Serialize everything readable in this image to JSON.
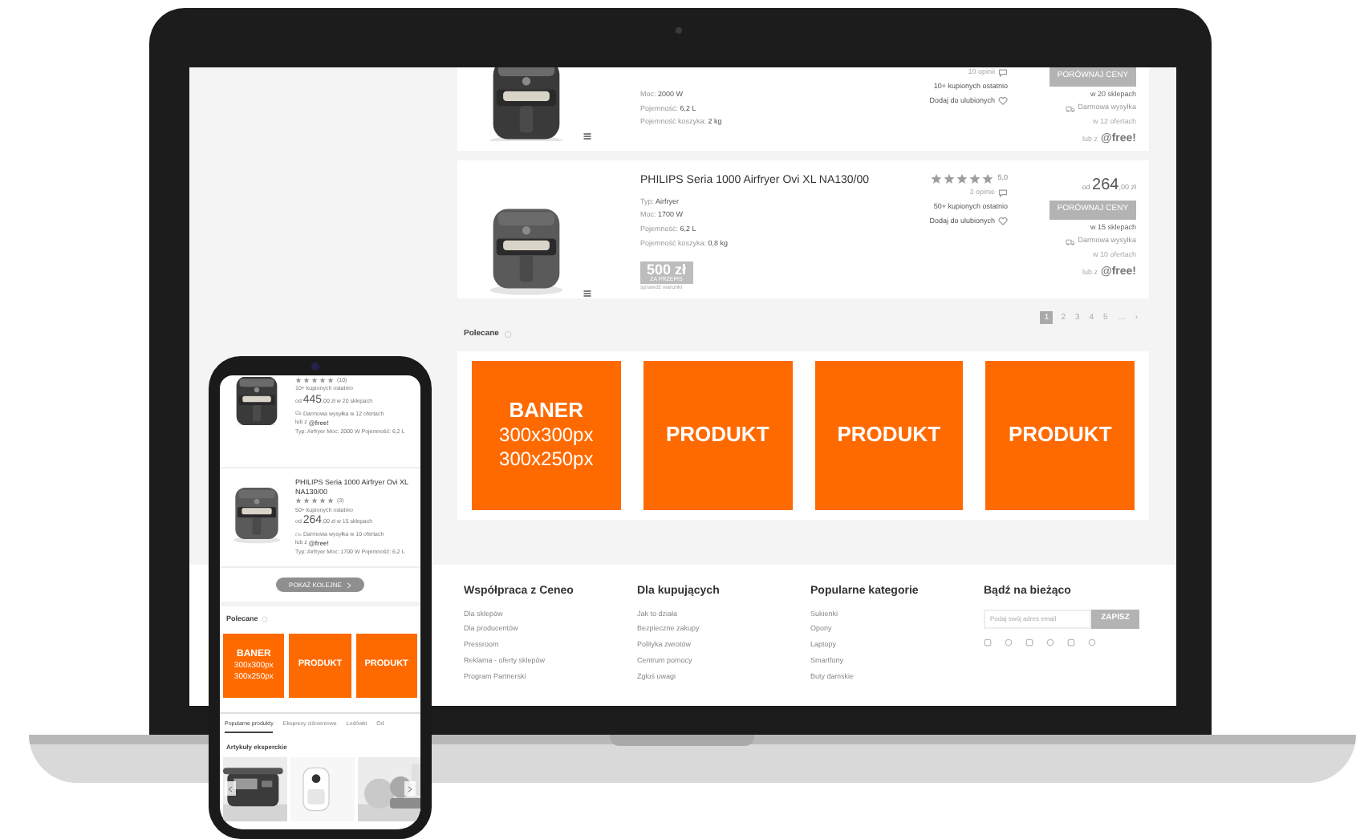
{
  "laptop": {
    "products": [
      {
        "specs": [
          {
            "label": "Moc:",
            "value": "2000 W"
          },
          {
            "label": "Pojemność:",
            "value": "6,2 L"
          },
          {
            "label": "Pojemność koszyka:",
            "value": "2 kg"
          }
        ],
        "opinions": "10 opinii",
        "bought": "10+ kupionych ostatnio",
        "favorite": "Dodaj do ulubionych",
        "compare": "PORÓWNAJ CENY",
        "shops": "w 20 sklepach",
        "shipping": "Darmowa wysyłka",
        "offers": "w 12 ofertach",
        "alt": "lub z",
        "alt_brand": "@free!"
      },
      {
        "title": "PHILIPS Seria 1000 Airfryer Ovi XL NA130/00",
        "specs": [
          {
            "label": "Typ:",
            "value": "Airfryer"
          },
          {
            "label": "Moc:",
            "value": "1700 W"
          },
          {
            "label": "Pojemność:",
            "value": "6,2 L"
          },
          {
            "label": "Pojemność koszyka:",
            "value": "0,8 kg"
          }
        ],
        "badge": {
          "amount": "500 zł",
          "caption": "ZA PRZEPIS",
          "note": "sprawdź warunki"
        },
        "stars": 5,
        "score": "5,0",
        "opinions": "3 opinie",
        "bought": "50+ kupionych ostatnio",
        "favorite": "Dodaj do ulubionych",
        "price_prefix": "od",
        "price": "264",
        "price_suffix": ",00 zł",
        "compare": "PORÓWNAJ CENY",
        "shops": "w 15 sklepach",
        "shipping": "Darmowa wysyłka",
        "offers": "w 10 ofertach",
        "alt": "lub z",
        "alt_brand": "@free!"
      }
    ],
    "pagination": [
      {
        "label": "1",
        "selected": true
      },
      {
        "label": "2",
        "selected": false
      },
      {
        "label": "3",
        "selected": false
      },
      {
        "label": "4",
        "selected": false
      },
      {
        "label": "5",
        "selected": false
      },
      {
        "label": "…",
        "selected": false
      },
      {
        "label": "›",
        "selected": false
      }
    ],
    "recommended": {
      "title": "Polecane",
      "tiles": [
        {
          "kind": "banner",
          "lines": [
            "BANER",
            "300x300px",
            "300x250px"
          ]
        },
        {
          "kind": "product",
          "label": "PRODUKT"
        },
        {
          "kind": "product",
          "label": "PRODUKT"
        },
        {
          "kind": "product",
          "label": "PRODUKT"
        }
      ]
    },
    "footer": {
      "columns": [
        {
          "title": "Współpraca z Ceneo",
          "links": [
            "Dla sklepów",
            "Dla producentów",
            "Pressroom",
            "Reklama - oferty sklepów",
            "Program Partnerski"
          ]
        },
        {
          "title": "Dla kupujących",
          "links": [
            "Jak to działa",
            "Bezpieczne zakupy",
            "Polityka zwrotów",
            "Centrum pomocy",
            "Zgłoś uwagi"
          ]
        },
        {
          "title": "Popularne kategorie",
          "links": [
            "Sukienki",
            "Opony",
            "Laptopy",
            "Smartfony",
            "Buty damskie"
          ]
        }
      ],
      "newsletter": {
        "title": "Bądź na bieżąco",
        "placeholder": "Podaj swój adres email",
        "button": "ZAPISZ"
      }
    }
  },
  "phone": {
    "products": [
      {
        "reviews": "(10)",
        "bought": "10+ kupionych ostatnio",
        "price_prefix": "od",
        "price": "445",
        "price_suffix": ",00 zł",
        "shops": "w 20 sklepach",
        "shipping": "Darmowa wysyłka w 12 ofertach",
        "alt": "lub z",
        "alt_brand": "@free!",
        "specs": "Typ: Airfryer Moc: 2000 W Pojemność: 6,2 L"
      },
      {
        "title": "PHILIPS Seria 1000 Airfryer Ovi XL NA130/00",
        "reviews": "(3)",
        "bought": "50+ kupionych ostatnio",
        "price_prefix": "od",
        "price": "264",
        "price_suffix": ",00 zł",
        "shops": "w 15 sklepach",
        "shipping": "Darmowa wysyłka w 10 ofertach",
        "alt": "lub z",
        "alt_brand": "@free!",
        "specs": "Typ: Airfryer Moc: 1700 W Pojemność: 6,2 L"
      }
    ],
    "more_button": "POKAŻ KOLEJNE",
    "recommended": {
      "title": "Polecane",
      "tiles": [
        {
          "kind": "banner",
          "lines": [
            "BANER",
            "300x300px",
            "300x250px"
          ]
        },
        {
          "kind": "product",
          "label": "PRODUKT"
        },
        {
          "kind": "product",
          "label": "PRODUKT"
        }
      ]
    },
    "tabs": [
      {
        "label": "Popularne produkty",
        "selected": true
      },
      {
        "label": "Ekspresy ciśnieniowe",
        "selected": false
      },
      {
        "label": "Lodówki",
        "selected": false
      },
      {
        "label": "Od",
        "selected": false
      }
    ],
    "articles_title": "Artykuły eksperckie"
  }
}
